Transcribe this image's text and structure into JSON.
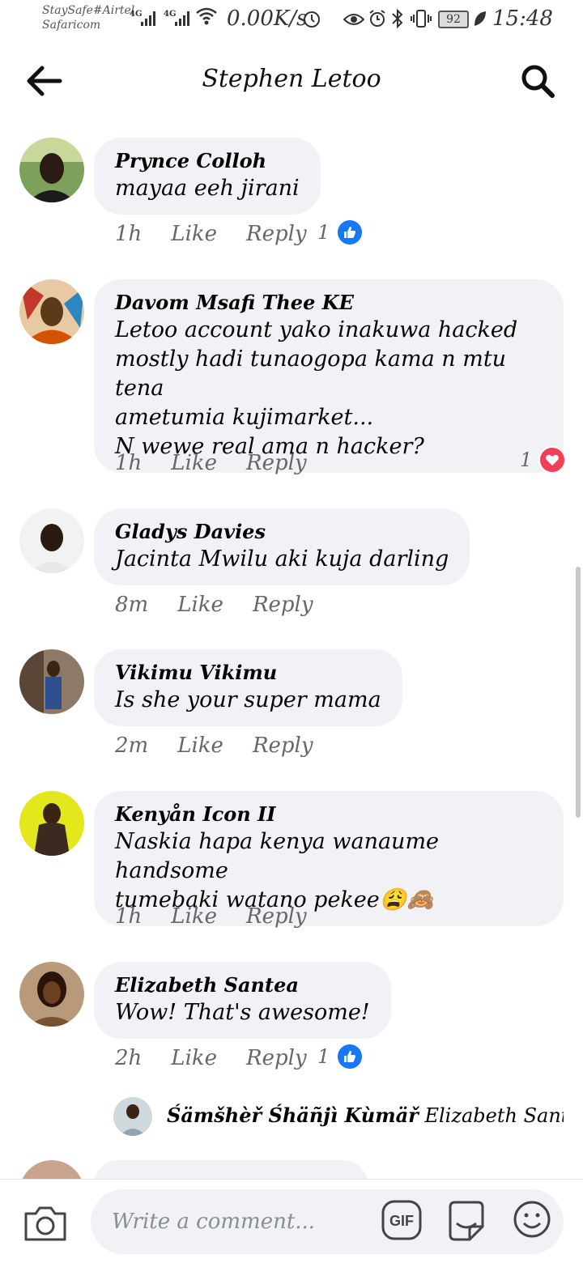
{
  "status_bar": {
    "carrier_1": "StaySafe#Airtel",
    "carrier_2": "Safaricom",
    "network_1": "4G",
    "network_2": "4G",
    "speed": "0.00K/s",
    "battery": "92",
    "time": "15:48"
  },
  "header": {
    "title": "Stephen Letoo"
  },
  "comments": [
    {
      "author": "Prynce Colloh",
      "text": "mayaa eeh jirani",
      "time": "1h",
      "like_label": "Like",
      "reply_label": "Reply",
      "reaction_count": "1",
      "reaction": "like"
    },
    {
      "author": "Davom Msafi Thee KE",
      "text": "Letoo account yako inakuwa hacked\nmostly hadi tunaogopa kama n mtu tena\nametumia kujimarket...\nN wewe real ama n hacker?",
      "time": "1h",
      "like_label": "Like",
      "reply_label": "Reply",
      "reaction_count": "1",
      "reaction": "love"
    },
    {
      "author": "Gladys Davies",
      "text": "Jacinta Mwilu aki kuja darling",
      "time": "8m",
      "like_label": "Like",
      "reply_label": "Reply"
    },
    {
      "author": "Vikimu Vikimu",
      "text": "Is she your super mama",
      "time": "2m",
      "like_label": "Like",
      "reply_label": "Reply"
    },
    {
      "author": "Kenyån Icon II",
      "text": "Naskia hapa kenya wanaume handsome\ntumebaki watano pekee😩🙈",
      "time": "1h",
      "like_label": "Like",
      "reply_label": "Reply"
    },
    {
      "author": "Elizabeth Santea",
      "text": "Wow! That's awesome!",
      "time": "2h",
      "like_label": "Like",
      "reply_label": "Reply",
      "reaction_count": "1",
      "reaction": "like"
    }
  ],
  "reply_preview": {
    "author": "Śämšhèř Śhäñjì Kùmäř",
    "text": "Elizabeth Santea send..."
  },
  "composer": {
    "placeholder": "Write a comment...",
    "gif_label": "GIF"
  },
  "colors": {
    "bubble": "#f0f2f5",
    "meta_text": "#65676b",
    "like_blue": "#1877f2",
    "love_red": "#f33e58"
  },
  "icons": {
    "back": "arrow-left-icon",
    "search": "search-icon",
    "camera": "camera-icon",
    "gif": "gif-icon",
    "sticker": "sticker-icon",
    "emoji": "emoji-icon"
  }
}
